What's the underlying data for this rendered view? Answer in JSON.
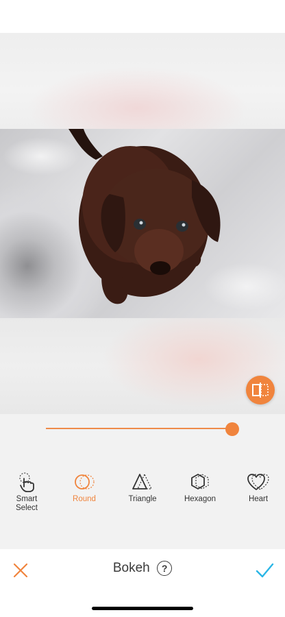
{
  "editor": {
    "title": "Bokeh",
    "help_icon": "?",
    "slider": {
      "value": 1.0
    }
  },
  "tools": [
    {
      "id": "smart-select",
      "label": "Smart\nSelect",
      "icon": "hand-tap-icon",
      "active": false
    },
    {
      "id": "round",
      "label": "Round",
      "icon": "circle-shape-icon",
      "active": true
    },
    {
      "id": "triangle",
      "label": "Triangle",
      "icon": "triangle-shape-icon",
      "active": false
    },
    {
      "id": "hexagon",
      "label": "Hexagon",
      "icon": "hexagon-shape-icon",
      "active": false
    },
    {
      "id": "heart",
      "label": "Heart",
      "icon": "heart-shape-icon",
      "active": false
    }
  ],
  "colors": {
    "accent": "#f0843d",
    "confirm": "#2ab6e6",
    "text": "#333333"
  }
}
